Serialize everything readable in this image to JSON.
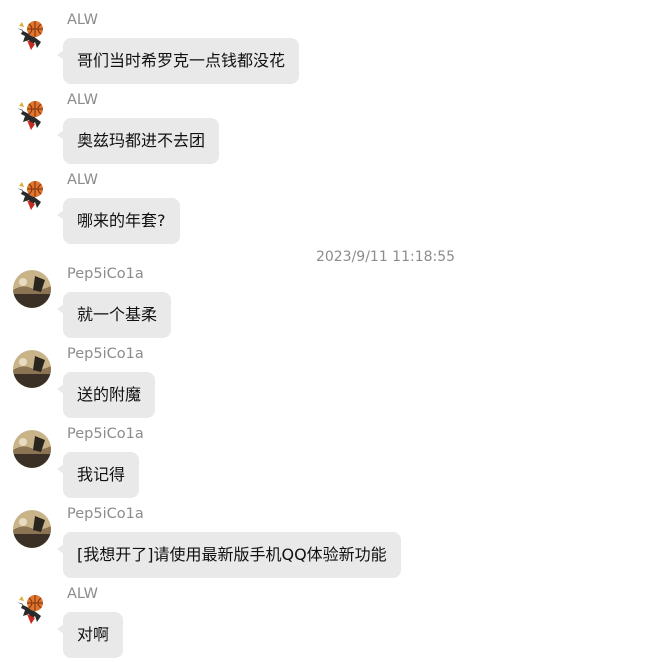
{
  "messages": [
    {
      "sender": "ALW",
      "text": "哥们当时希罗克一点钱都没花",
      "avatar": "basketball-avatar-icon"
    },
    {
      "sender": "ALW",
      "text": "奥兹玛都进不去团",
      "avatar": "basketball-avatar-icon"
    },
    {
      "sender": "ALW",
      "text": "哪来的年套?",
      "avatar": "basketball-avatar-icon"
    },
    {
      "sender": "Pep5iCo1a",
      "text": "就一个基柔",
      "avatar": "photo-avatar-icon"
    },
    {
      "sender": "Pep5iCo1a",
      "text": "送的附魔",
      "avatar": "photo-avatar-icon"
    },
    {
      "sender": "Pep5iCo1a",
      "text": "我记得",
      "avatar": "photo-avatar-icon"
    },
    {
      "sender": "Pep5iCo1a",
      "text": "[我想开了]请使用最新版手机QQ体验新功能",
      "avatar": "photo-avatar-icon"
    },
    {
      "sender": "ALW",
      "text": "对啊",
      "avatar": "basketball-avatar-icon"
    }
  ],
  "timestamp": "2023/9/11 11:18:55",
  "colors": {
    "bubble": "#e9e9e9",
    "sender": "#8c8c8c",
    "text": "#111111",
    "background": "#ffffff"
  }
}
